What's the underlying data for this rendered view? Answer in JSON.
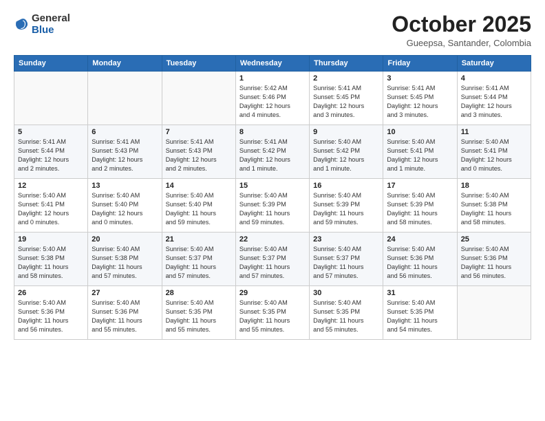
{
  "header": {
    "logo_general": "General",
    "logo_blue": "Blue",
    "month_title": "October 2025",
    "location": "Gueepsa, Santander, Colombia"
  },
  "calendar": {
    "headers": [
      "Sunday",
      "Monday",
      "Tuesday",
      "Wednesday",
      "Thursday",
      "Friday",
      "Saturday"
    ],
    "weeks": [
      [
        {
          "day": "",
          "info": ""
        },
        {
          "day": "",
          "info": ""
        },
        {
          "day": "",
          "info": ""
        },
        {
          "day": "1",
          "info": "Sunrise: 5:42 AM\nSunset: 5:46 PM\nDaylight: 12 hours\nand 4 minutes."
        },
        {
          "day": "2",
          "info": "Sunrise: 5:41 AM\nSunset: 5:45 PM\nDaylight: 12 hours\nand 3 minutes."
        },
        {
          "day": "3",
          "info": "Sunrise: 5:41 AM\nSunset: 5:45 PM\nDaylight: 12 hours\nand 3 minutes."
        },
        {
          "day": "4",
          "info": "Sunrise: 5:41 AM\nSunset: 5:44 PM\nDaylight: 12 hours\nand 3 minutes."
        }
      ],
      [
        {
          "day": "5",
          "info": "Sunrise: 5:41 AM\nSunset: 5:44 PM\nDaylight: 12 hours\nand 2 minutes."
        },
        {
          "day": "6",
          "info": "Sunrise: 5:41 AM\nSunset: 5:43 PM\nDaylight: 12 hours\nand 2 minutes."
        },
        {
          "day": "7",
          "info": "Sunrise: 5:41 AM\nSunset: 5:43 PM\nDaylight: 12 hours\nand 2 minutes."
        },
        {
          "day": "8",
          "info": "Sunrise: 5:41 AM\nSunset: 5:42 PM\nDaylight: 12 hours\nand 1 minute."
        },
        {
          "day": "9",
          "info": "Sunrise: 5:40 AM\nSunset: 5:42 PM\nDaylight: 12 hours\nand 1 minute."
        },
        {
          "day": "10",
          "info": "Sunrise: 5:40 AM\nSunset: 5:41 PM\nDaylight: 12 hours\nand 1 minute."
        },
        {
          "day": "11",
          "info": "Sunrise: 5:40 AM\nSunset: 5:41 PM\nDaylight: 12 hours\nand 0 minutes."
        }
      ],
      [
        {
          "day": "12",
          "info": "Sunrise: 5:40 AM\nSunset: 5:41 PM\nDaylight: 12 hours\nand 0 minutes."
        },
        {
          "day": "13",
          "info": "Sunrise: 5:40 AM\nSunset: 5:40 PM\nDaylight: 12 hours\nand 0 minutes."
        },
        {
          "day": "14",
          "info": "Sunrise: 5:40 AM\nSunset: 5:40 PM\nDaylight: 11 hours\nand 59 minutes."
        },
        {
          "day": "15",
          "info": "Sunrise: 5:40 AM\nSunset: 5:39 PM\nDaylight: 11 hours\nand 59 minutes."
        },
        {
          "day": "16",
          "info": "Sunrise: 5:40 AM\nSunset: 5:39 PM\nDaylight: 11 hours\nand 59 minutes."
        },
        {
          "day": "17",
          "info": "Sunrise: 5:40 AM\nSunset: 5:39 PM\nDaylight: 11 hours\nand 58 minutes."
        },
        {
          "day": "18",
          "info": "Sunrise: 5:40 AM\nSunset: 5:38 PM\nDaylight: 11 hours\nand 58 minutes."
        }
      ],
      [
        {
          "day": "19",
          "info": "Sunrise: 5:40 AM\nSunset: 5:38 PM\nDaylight: 11 hours\nand 58 minutes."
        },
        {
          "day": "20",
          "info": "Sunrise: 5:40 AM\nSunset: 5:38 PM\nDaylight: 11 hours\nand 57 minutes."
        },
        {
          "day": "21",
          "info": "Sunrise: 5:40 AM\nSunset: 5:37 PM\nDaylight: 11 hours\nand 57 minutes."
        },
        {
          "day": "22",
          "info": "Sunrise: 5:40 AM\nSunset: 5:37 PM\nDaylight: 11 hours\nand 57 minutes."
        },
        {
          "day": "23",
          "info": "Sunrise: 5:40 AM\nSunset: 5:37 PM\nDaylight: 11 hours\nand 57 minutes."
        },
        {
          "day": "24",
          "info": "Sunrise: 5:40 AM\nSunset: 5:36 PM\nDaylight: 11 hours\nand 56 minutes."
        },
        {
          "day": "25",
          "info": "Sunrise: 5:40 AM\nSunset: 5:36 PM\nDaylight: 11 hours\nand 56 minutes."
        }
      ],
      [
        {
          "day": "26",
          "info": "Sunrise: 5:40 AM\nSunset: 5:36 PM\nDaylight: 11 hours\nand 56 minutes."
        },
        {
          "day": "27",
          "info": "Sunrise: 5:40 AM\nSunset: 5:36 PM\nDaylight: 11 hours\nand 55 minutes."
        },
        {
          "day": "28",
          "info": "Sunrise: 5:40 AM\nSunset: 5:35 PM\nDaylight: 11 hours\nand 55 minutes."
        },
        {
          "day": "29",
          "info": "Sunrise: 5:40 AM\nSunset: 5:35 PM\nDaylight: 11 hours\nand 55 minutes."
        },
        {
          "day": "30",
          "info": "Sunrise: 5:40 AM\nSunset: 5:35 PM\nDaylight: 11 hours\nand 55 minutes."
        },
        {
          "day": "31",
          "info": "Sunrise: 5:40 AM\nSunset: 5:35 PM\nDaylight: 11 hours\nand 54 minutes."
        },
        {
          "day": "",
          "info": ""
        }
      ]
    ]
  }
}
